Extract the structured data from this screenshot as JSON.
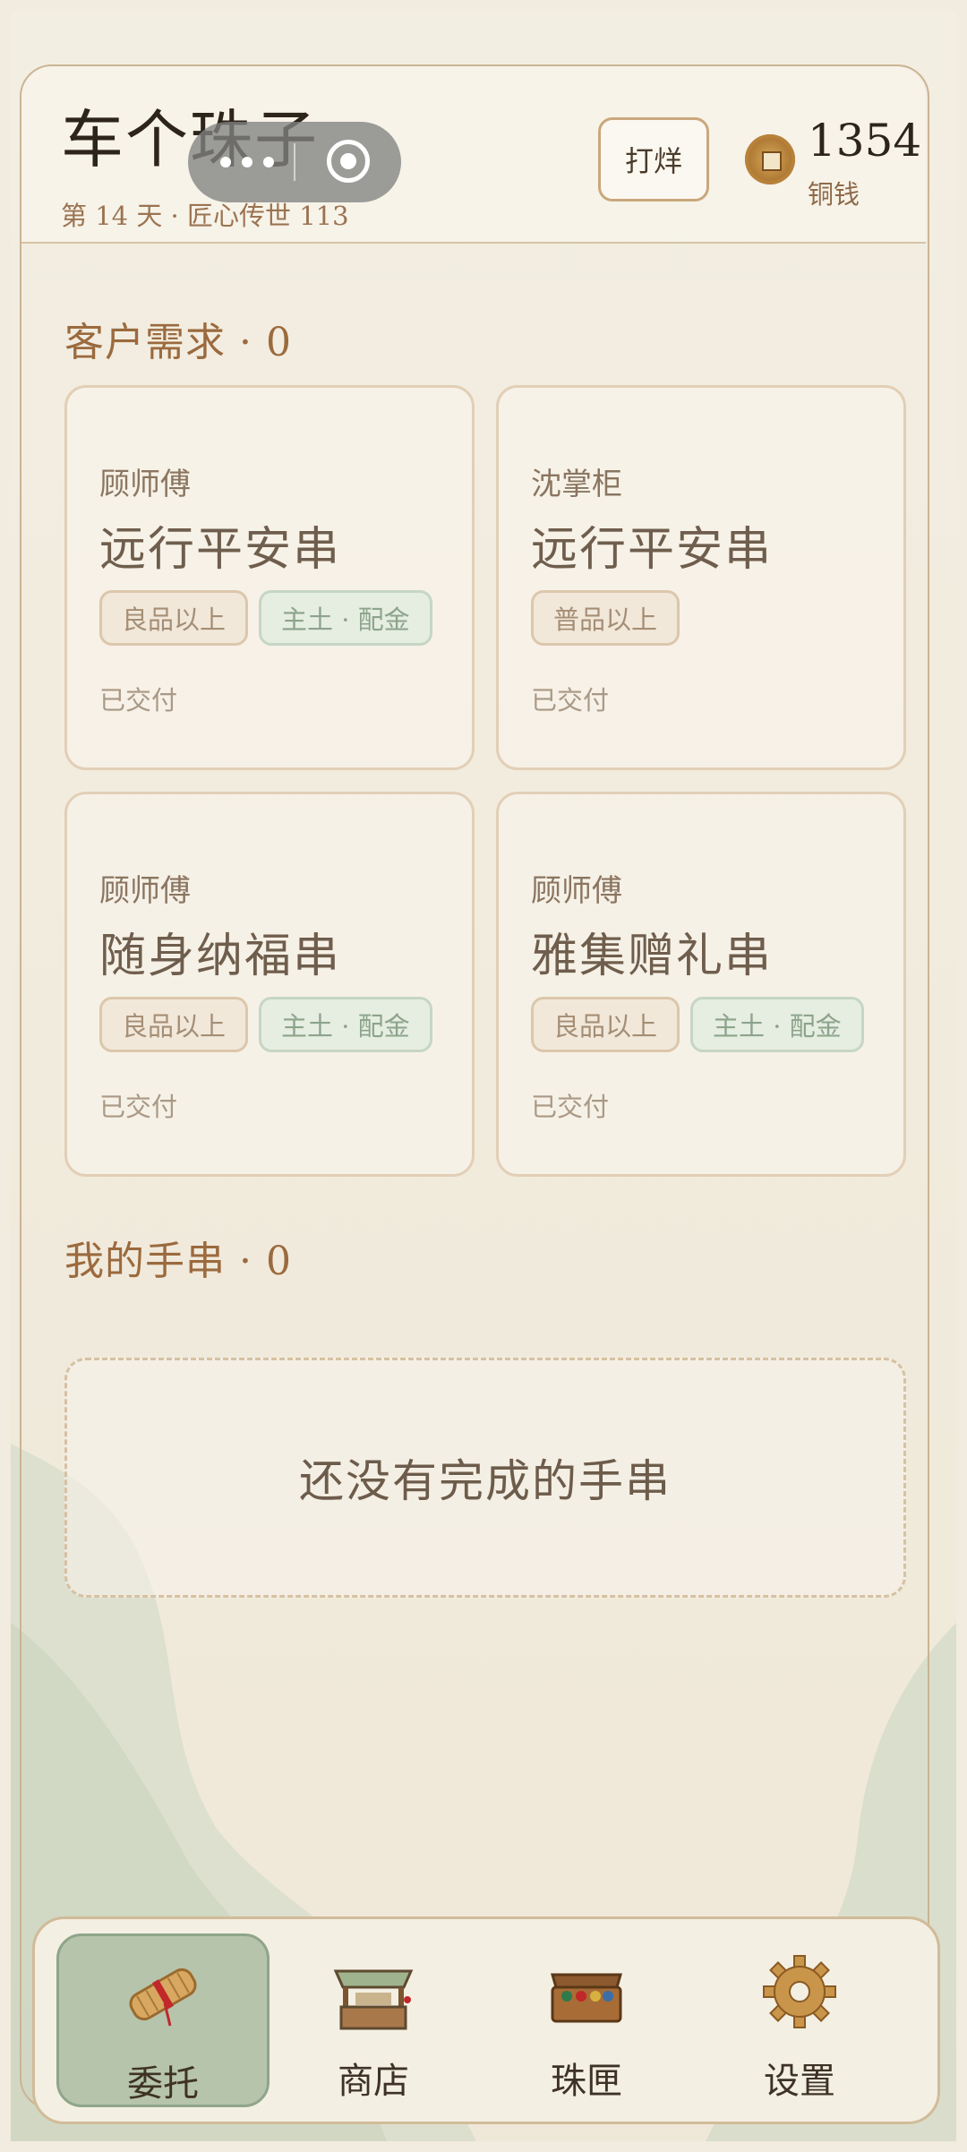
{
  "header": {
    "app_title": "车个珠子",
    "subtitle": "第 14 天 · 匠心传世 113",
    "close_shop_label": "打烊",
    "coins": "1354",
    "coins_label": "铜钱"
  },
  "requests": {
    "title": "客户需求 · 0",
    "cards": [
      {
        "client": "顾师傅",
        "item": "远行平安串",
        "tags": [
          "良品以上",
          "主土 · 配金"
        ],
        "status": "已交付"
      },
      {
        "client": "沈掌柜",
        "item": "远行平安串",
        "tags": [
          "普品以上"
        ],
        "status": "已交付"
      },
      {
        "client": "顾师傅",
        "item": "随身纳福串",
        "tags": [
          "良品以上",
          "主土 · 配金"
        ],
        "status": "已交付"
      },
      {
        "client": "顾师傅",
        "item": "雅集赠礼串",
        "tags": [
          "良品以上",
          "主土 · 配金"
        ],
        "status": "已交付"
      }
    ]
  },
  "bracelets": {
    "title": "我的手串 · 0",
    "empty_text": "还没有完成的手串"
  },
  "nav": {
    "items": [
      {
        "label": "委托",
        "icon": "scroll-icon",
        "active": true
      },
      {
        "label": "商店",
        "icon": "shop-stall-icon",
        "active": false
      },
      {
        "label": "珠匣",
        "icon": "bead-box-icon",
        "active": false
      },
      {
        "label": "设置",
        "icon": "gear-icon",
        "active": false
      }
    ]
  },
  "colors": {
    "background": "#f1ecdf",
    "accent_brown": "#9b6a3e",
    "nav_active": "#b6c4ab",
    "tag_green": "#e6ede1"
  }
}
